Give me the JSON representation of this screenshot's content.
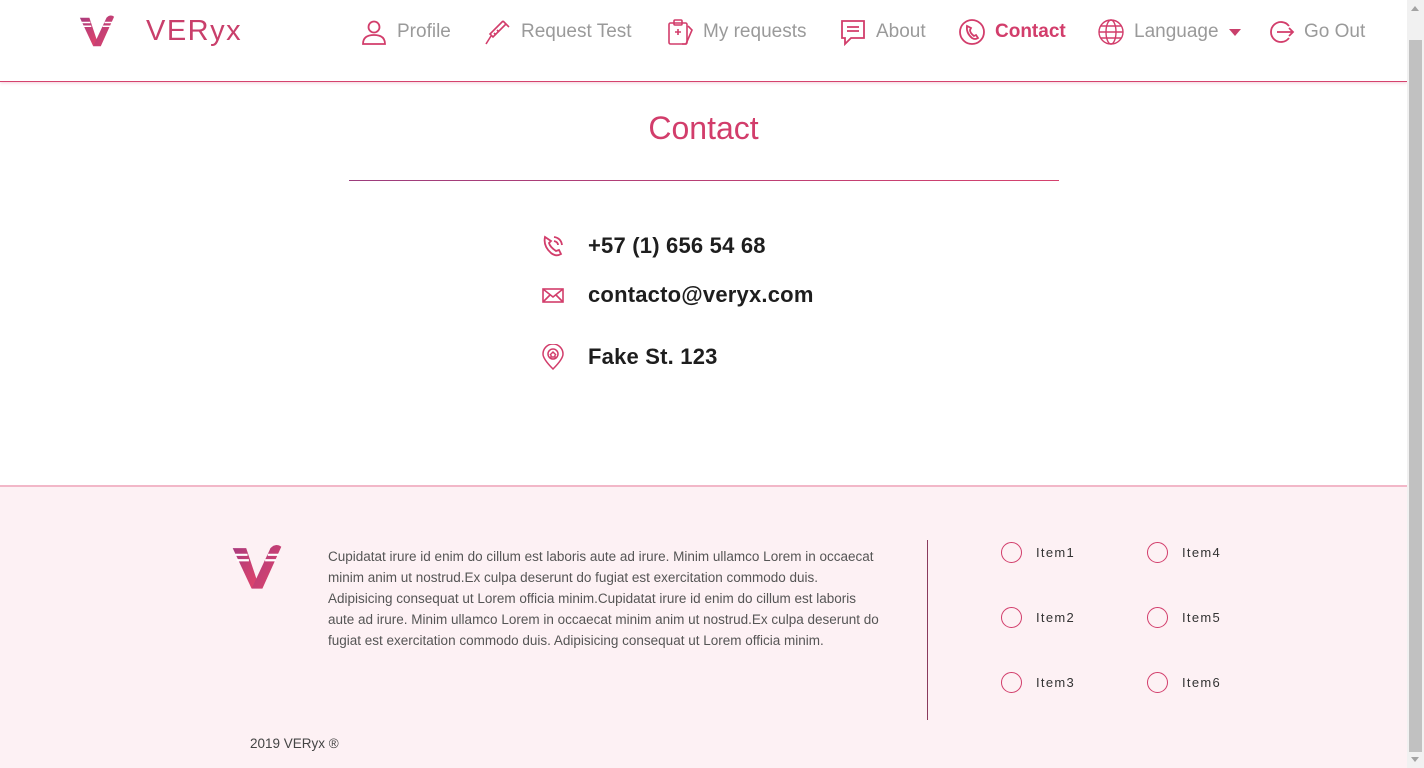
{
  "brand": {
    "name": "VERyx",
    "logo_icon": "veryx-logo-icon"
  },
  "nav": {
    "items": [
      {
        "label": "Profile",
        "icon": "user-icon"
      },
      {
        "label": "Request Test",
        "icon": "syringe-icon"
      },
      {
        "label": "My requests",
        "icon": "clipboard-icon"
      },
      {
        "label": "About",
        "icon": "message-icon"
      },
      {
        "label": "Contact",
        "icon": "phone-icon",
        "active": true
      },
      {
        "label": "Language",
        "icon": "globe-icon",
        "dropdown": true
      },
      {
        "label": "Go Out",
        "icon": "logout-icon"
      }
    ]
  },
  "main": {
    "title": "Contact",
    "contacts": [
      {
        "icon": "phone-icon",
        "value": "+57 (1) 656 54 68"
      },
      {
        "icon": "envelope-icon",
        "value": "contacto@veryx.com"
      },
      {
        "icon": "location-pin-icon",
        "value": "Fake St. 123"
      }
    ]
  },
  "footer": {
    "text": "Cupidatat irure id enim do cillum est laboris aute ad irure. Minim ullamco Lorem in occaecat minim anim ut nostrud.Ex culpa deserunt do fugiat est exercitation commodo duis. Adipisicing consequat ut Lorem officia minim.Cupidatat irure id enim do cillum est laboris aute ad irure. Minim ullamco Lorem in occaecat minim anim ut nostrud.Ex culpa deserunt do fugiat est exercitation commodo duis. Adipisicing consequat ut Lorem officia minim.",
    "items": [
      "Item1",
      "Item2",
      "Item3",
      "Item4",
      "Item5",
      "Item6"
    ],
    "copyright": "2019 VERyx ®"
  },
  "colors": {
    "accent": "#d23d6b",
    "accent_dark": "#9c3d7c",
    "footer_bg": "#fdf1f4",
    "nav_text": "#9a9a9a"
  }
}
